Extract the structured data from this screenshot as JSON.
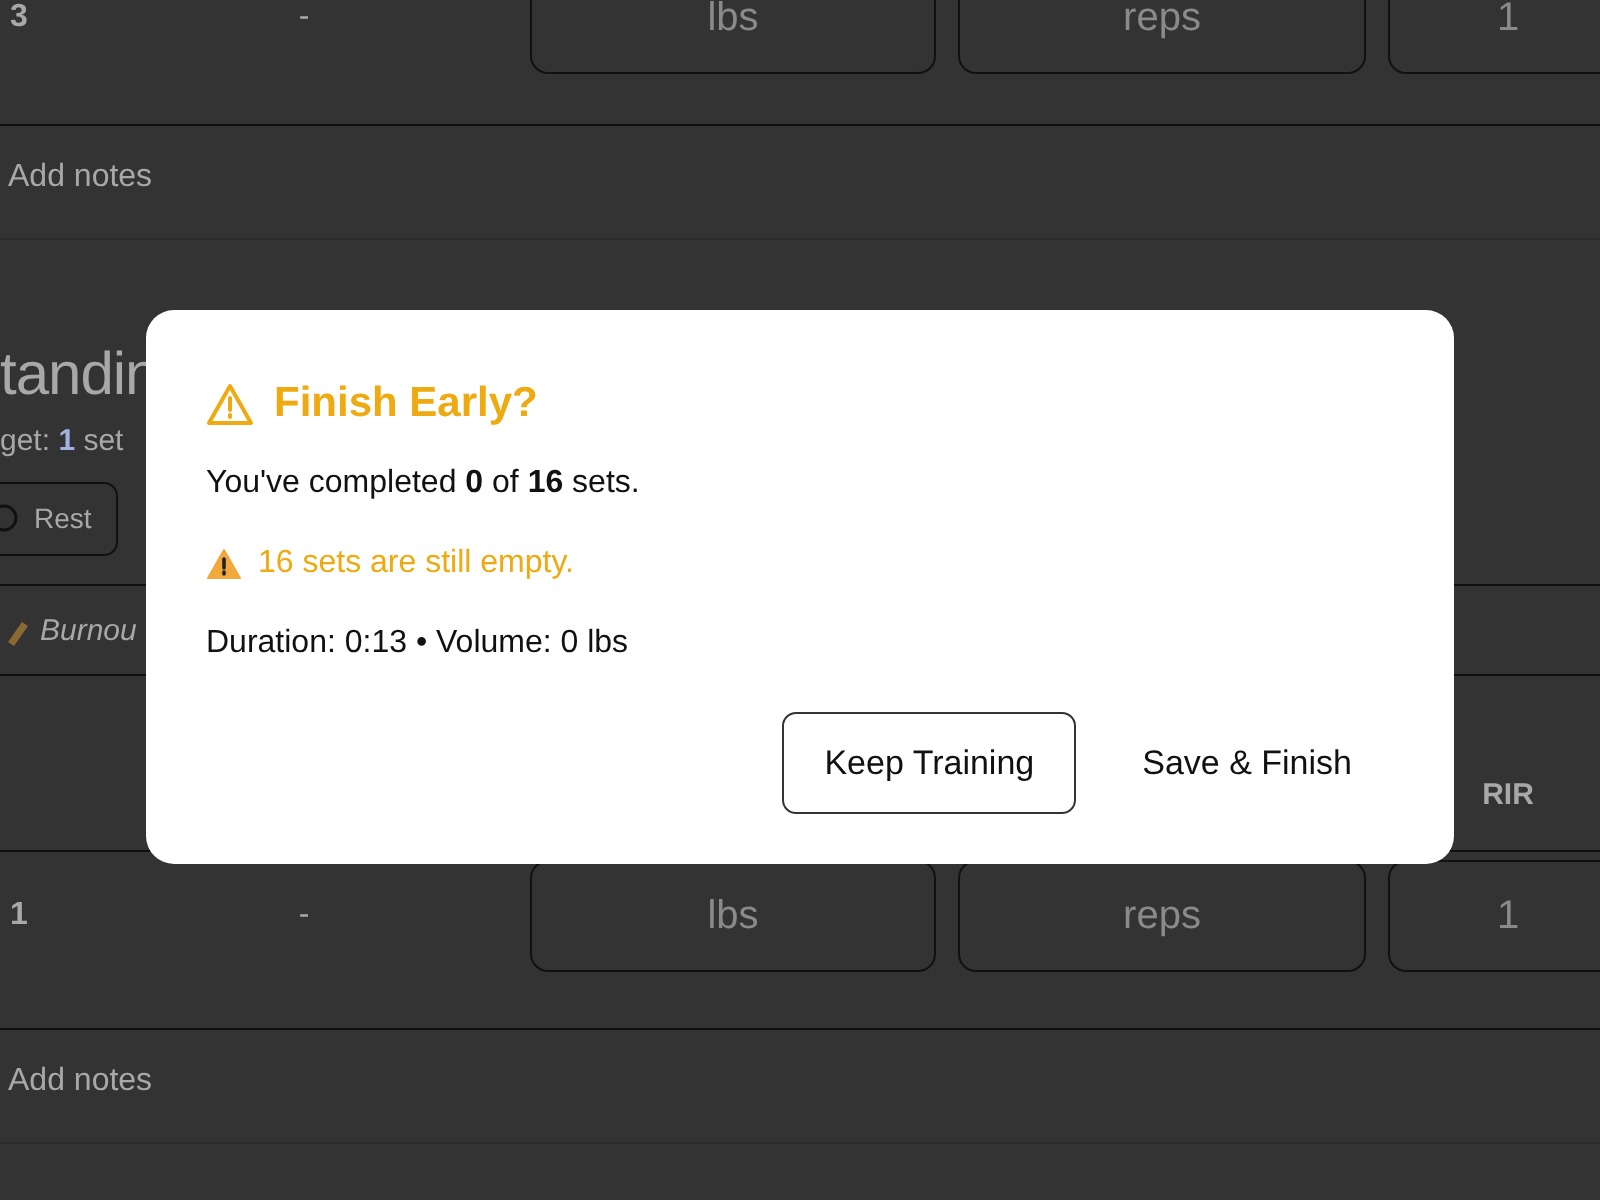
{
  "background": {
    "top_set_row": {
      "set": "3",
      "previous": "-",
      "inputs": [
        {
          "placeholder": "lbs"
        },
        {
          "placeholder": "reps"
        },
        {
          "placeholder": "1"
        }
      ]
    },
    "top_notes": {
      "placeholder": "Add notes"
    },
    "exercise": {
      "title": "tandin",
      "target": "get: **1** set",
      "rest_button": "Rest",
      "note": "Burnou",
      "columns": [
        "RIR"
      ],
      "sets": [
        {
          "set": "1",
          "previous": "-",
          "inputs": [
            {
              "placeholder": "lbs"
            },
            {
              "placeholder": "reps"
            },
            {
              "placeholder": "1"
            }
          ]
        }
      ],
      "notes": {
        "placeholder": "Add notes"
      }
    }
  },
  "dialog": {
    "title": "Finish Early?",
    "summary": "You've completed **0** of **16** sets.",
    "warning": "16 sets are still empty.",
    "stats": "Duration: 0:13 • Volume: 0 lbs",
    "buttons": [
      {
        "label": "Keep Training",
        "kind": "outline"
      },
      {
        "label": "Save & Finish",
        "kind": "plain"
      }
    ]
  }
}
